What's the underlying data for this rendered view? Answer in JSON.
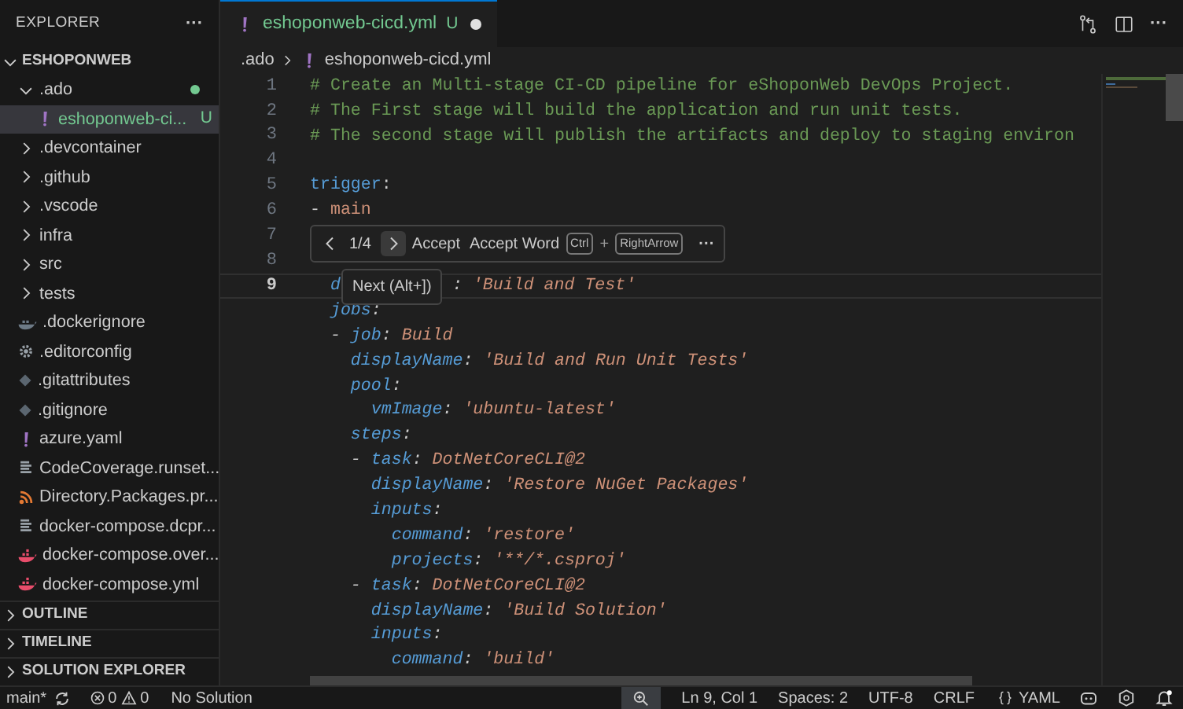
{
  "sidebar": {
    "title": "EXPLORER",
    "more": "···",
    "tree": {
      "label": "ESHOPONWEB",
      "expanded": true,
      "children": [
        {
          "label": ".ado",
          "kind": "folder",
          "expanded": true,
          "modified": true,
          "children": [
            {
              "label": "eshoponweb-ci...",
              "kind": "yaml",
              "badge": "U",
              "selected": true,
              "untracked": true
            }
          ]
        },
        {
          "label": ".devcontainer",
          "kind": "folder",
          "expanded": false
        },
        {
          "label": ".github",
          "kind": "folder",
          "expanded": false
        },
        {
          "label": ".vscode",
          "kind": "folder",
          "expanded": false
        },
        {
          "label": "infra",
          "kind": "folder",
          "expanded": false
        },
        {
          "label": "src",
          "kind": "folder",
          "expanded": false
        },
        {
          "label": "tests",
          "kind": "folder",
          "expanded": false
        },
        {
          "label": ".dockerignore",
          "kind": "whale-grey"
        },
        {
          "label": ".editorconfig",
          "kind": "gear"
        },
        {
          "label": ".gitattributes",
          "kind": "diamond"
        },
        {
          "label": ".gitignore",
          "kind": "diamond"
        },
        {
          "label": "azure.yaml",
          "kind": "yaml"
        },
        {
          "label": "CodeCoverage.runset...",
          "kind": "lines"
        },
        {
          "label": "Directory.Packages.pr...",
          "kind": "rss"
        },
        {
          "label": "docker-compose.dcpr...",
          "kind": "lines"
        },
        {
          "label": "docker-compose.over...",
          "kind": "whale"
        },
        {
          "label": "docker-compose.yml",
          "kind": "whale"
        }
      ]
    },
    "sections": [
      {
        "label": "OUTLINE",
        "expanded": false
      },
      {
        "label": "TIMELINE",
        "expanded": false
      },
      {
        "label": "SOLUTION EXPLORER",
        "expanded": false
      }
    ]
  },
  "tab": {
    "label": "eshoponweb-cicd.yml",
    "badge": "U",
    "dirty": true,
    "selected": true
  },
  "breadcrumb": [
    {
      "label": ".ado"
    },
    {
      "label": "eshoponweb-cicd.yml",
      "kind": "yaml"
    }
  ],
  "editor": {
    "lines": [
      {
        "number": "1",
        "current": false,
        "suggested": false,
        "tokens": [
          {
            "kind": "comment",
            "text": "# Create an Multi-stage CI-CD pipeline for eShoponWeb DevOps Project."
          }
        ]
      },
      {
        "number": "2",
        "current": false,
        "suggested": false,
        "tokens": [
          {
            "kind": "comment",
            "text": "# The First stage will build the application and run unit tests."
          }
        ]
      },
      {
        "number": "3",
        "current": false,
        "suggested": false,
        "tokens": [
          {
            "kind": "comment",
            "text": "# The second stage will publish the artifacts and deploy to staging environ"
          }
        ]
      },
      {
        "number": "4",
        "current": false
      },
      {
        "number": "5",
        "current": false,
        "suggested": false,
        "tokens": [
          {
            "kind": "key",
            "text": "trigger"
          },
          {
            "kind": "punct",
            "text": ":"
          }
        ]
      },
      {
        "number": "6",
        "current": false,
        "suggested": false,
        "tokens": [
          {
            "kind": "punct",
            "text": "- "
          },
          {
            "kind": "string",
            "text": "main"
          }
        ]
      },
      {
        "number": "7",
        "current": false
      },
      {
        "number": "8",
        "current": false
      },
      {
        "number": "9",
        "current": true,
        "suggested": true,
        "tokens": [
          {
            "kind": "key",
            "text": "  d"
          },
          {
            "kind": "punct",
            "text": ": ",
            "after_tooltip": true
          },
          {
            "kind": "string",
            "text": "'Build and Test'"
          }
        ]
      },
      {
        "suggested": true,
        "tokens": [
          {
            "kind": "key",
            "text": "  jobs"
          },
          {
            "kind": "punct",
            "text": ":"
          }
        ]
      },
      {
        "suggested": true,
        "tokens": [
          {
            "kind": "punct",
            "text": "  - "
          },
          {
            "kind": "key",
            "text": "job"
          },
          {
            "kind": "punct",
            "text": ": "
          },
          {
            "kind": "string",
            "text": "Build"
          }
        ]
      },
      {
        "suggested": true,
        "tokens": [
          {
            "kind": "key",
            "text": "    displayName"
          },
          {
            "kind": "punct",
            "text": ": "
          },
          {
            "kind": "string",
            "text": "'Build and Run Unit Tests'"
          }
        ]
      },
      {
        "suggested": true,
        "tokens": [
          {
            "kind": "key",
            "text": "    pool"
          },
          {
            "kind": "punct",
            "text": ":"
          }
        ]
      },
      {
        "suggested": true,
        "tokens": [
          {
            "kind": "key",
            "text": "      vmImage"
          },
          {
            "kind": "punct",
            "text": ": "
          },
          {
            "kind": "string",
            "text": "'ubuntu-latest'"
          }
        ]
      },
      {
        "suggested": true,
        "tokens": [
          {
            "kind": "key",
            "text": "    steps"
          },
          {
            "kind": "punct",
            "text": ":"
          }
        ]
      },
      {
        "suggested": true,
        "tokens": [
          {
            "kind": "punct",
            "text": "    - "
          },
          {
            "kind": "key",
            "text": "task"
          },
          {
            "kind": "punct",
            "text": ": "
          },
          {
            "kind": "string",
            "text": "DotNetCoreCLI@2"
          }
        ]
      },
      {
        "suggested": true,
        "tokens": [
          {
            "kind": "key",
            "text": "      displayName"
          },
          {
            "kind": "punct",
            "text": ": "
          },
          {
            "kind": "string",
            "text": "'Restore NuGet Packages'"
          }
        ]
      },
      {
        "suggested": true,
        "tokens": [
          {
            "kind": "key",
            "text": "      inputs"
          },
          {
            "kind": "punct",
            "text": ":"
          }
        ]
      },
      {
        "suggested": true,
        "tokens": [
          {
            "kind": "key",
            "text": "        command"
          },
          {
            "kind": "punct",
            "text": ": "
          },
          {
            "kind": "string",
            "text": "'restore'"
          }
        ]
      },
      {
        "suggested": true,
        "tokens": [
          {
            "kind": "key",
            "text": "        projects"
          },
          {
            "kind": "punct",
            "text": ": "
          },
          {
            "kind": "string",
            "text": "'**/*.csproj'"
          }
        ]
      },
      {
        "suggested": true,
        "tokens": [
          {
            "kind": "punct",
            "text": "    - "
          },
          {
            "kind": "key",
            "text": "task"
          },
          {
            "kind": "punct",
            "text": ": "
          },
          {
            "kind": "string",
            "text": "DotNetCoreCLI@2"
          }
        ]
      },
      {
        "suggested": true,
        "tokens": [
          {
            "kind": "key",
            "text": "      displayName"
          },
          {
            "kind": "punct",
            "text": ": "
          },
          {
            "kind": "string",
            "text": "'Build Solution'"
          }
        ]
      },
      {
        "suggested": true,
        "tokens": [
          {
            "kind": "key",
            "text": "      inputs"
          },
          {
            "kind": "punct",
            "text": ":"
          }
        ]
      },
      {
        "suggested": true,
        "tokens": [
          {
            "kind": "key",
            "text": "        command"
          },
          {
            "kind": "punct",
            "text": ": "
          },
          {
            "kind": "string",
            "text": "'build'"
          }
        ]
      }
    ]
  },
  "suggestion_toolbar": {
    "counter": "1/4",
    "accept": "Accept",
    "accept_word": "Accept Word",
    "keys": [
      "Ctrl",
      "RightArrow"
    ],
    "plus": "+",
    "more": "···",
    "tooltip": "Next (Alt+])"
  },
  "status_bar": {
    "branch": "main*",
    "errors": "0",
    "warnings": "0",
    "solution": "No Solution",
    "right": [
      {
        "text": "Ln 9, Col 1"
      },
      {
        "text": "Spaces: 2"
      },
      {
        "text": "UTF-8"
      },
      {
        "text": "CRLF"
      },
      {
        "text": "YAML"
      }
    ]
  }
}
